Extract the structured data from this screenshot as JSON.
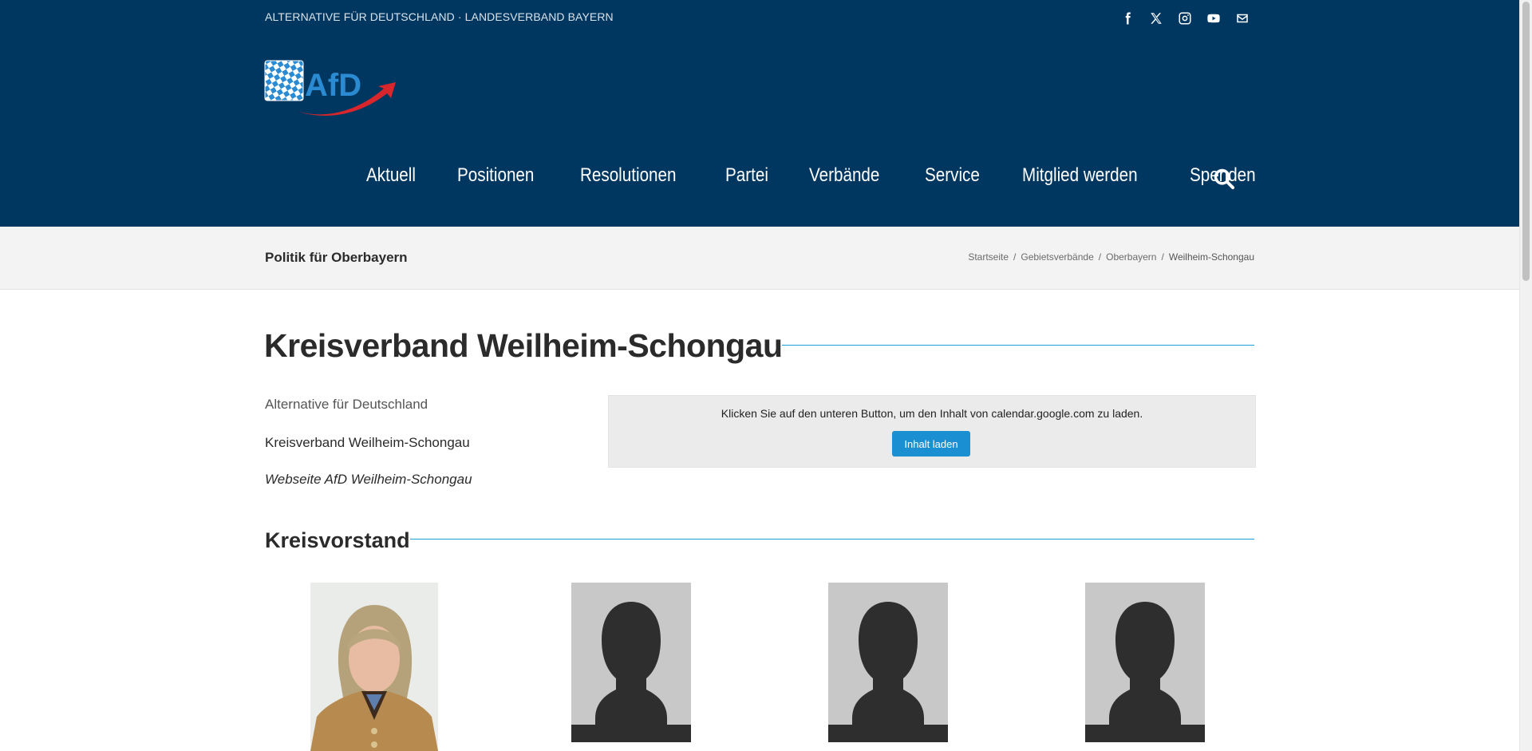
{
  "header": {
    "tagline": "ALTERNATIVE FÜR DEUTSCHLAND · LANDESVERBAND BAYERN",
    "logo_text": "AfD",
    "social": [
      "facebook-icon",
      "x-icon",
      "instagram-icon",
      "youtube-icon",
      "mail-icon"
    ],
    "nav": [
      "Aktuell",
      "Positionen",
      "Resolutionen",
      "Partei",
      "Verbände",
      "Service",
      "Mitglied werden",
      "Spenden"
    ],
    "search_icon": "search-icon"
  },
  "titlebar": {
    "subtitle": "Politik für Oberbayern",
    "breadcrumb": [
      "Startseite",
      "Gebietsverbände",
      "Oberbayern",
      "Weilheim-Schongau"
    ],
    "separator": "/"
  },
  "main": {
    "title": "Kreisverband Weilheim-Schongau",
    "party": "Alternative für Deutschland",
    "kreisverband": "Kreisverband Weilheim-Schongau",
    "website_link": "Webseite AfD Weilheim-Schongau",
    "embed": {
      "message": "Klicken Sie auf den unteren Button, um den Inhalt von calendar.google.com zu laden.",
      "button": "Inhalt laden"
    },
    "section_title": "Kreisvorstand"
  },
  "colors": {
    "header_bg": "#003760",
    "accent": "#1a9fd6",
    "button_bg": "#1a8fd1",
    "titlebar_bg": "#f3f3f3",
    "logo_blue": "#2a8ad2",
    "logo_red": "#d9262c"
  }
}
